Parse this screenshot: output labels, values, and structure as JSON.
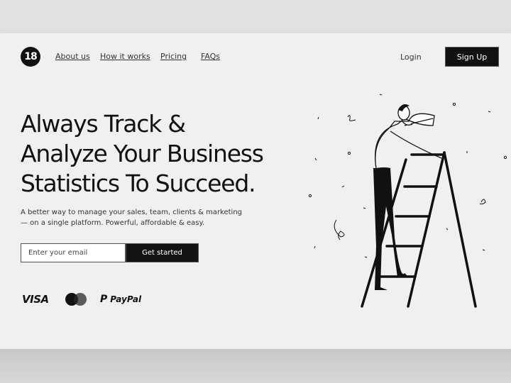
{
  "brand": {
    "logo_text": "18"
  },
  "nav": {
    "items": [
      {
        "label": "About us"
      },
      {
        "label": "How it works"
      },
      {
        "label": "Pricing"
      },
      {
        "label": "FAQs"
      }
    ],
    "login_label": "Login",
    "signup_label": "Sign Up"
  },
  "hero": {
    "headline_lines": [
      "Always Track &",
      "Analyze Your Business",
      "Statistics To Succeed."
    ],
    "subtext_line1": "A better way to manage your sales, team, clients & marketing",
    "subtext_line2": "— on a single platform. Powerful, affordable & easy.",
    "email_placeholder": "Enter your email",
    "cta_label": "Get started"
  },
  "payments": {
    "visa": "VISA",
    "mastercard_icon": "mastercard-icon",
    "paypal_glyph": "P",
    "paypal": "PayPal"
  },
  "illustration": {
    "subject": "man-on-ladder-illustration"
  }
}
